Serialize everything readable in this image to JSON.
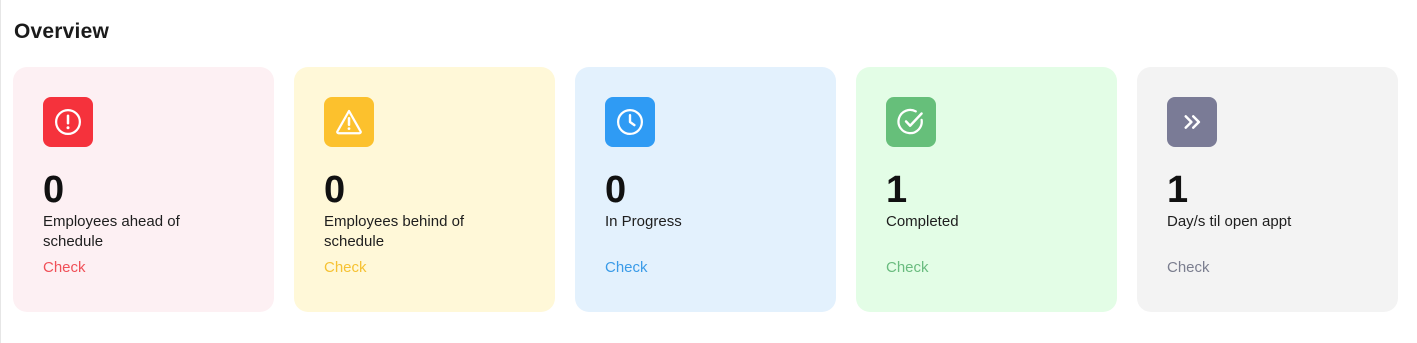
{
  "overview": {
    "title": "Overview"
  },
  "cards": [
    {
      "value": "0",
      "label": "Employees ahead of schedule",
      "check_label": "Check",
      "icon": "exclamation-circle-icon",
      "background_color": "#fdf0f3",
      "icon_color": "#f5323c",
      "check_color": "#f05058"
    },
    {
      "value": "0",
      "label": "Employees behind of schedule",
      "check_label": "Check",
      "icon": "warning-triangle-icon",
      "background_color": "#fff8d8",
      "icon_color": "#fcc12d",
      "check_color": "#f6c233"
    },
    {
      "value": "0",
      "label": "In Progress",
      "check_label": "Check",
      "icon": "clock-icon",
      "background_color": "#e3f1fd",
      "icon_color": "#2f9bf4",
      "check_color": "#3a9be8"
    },
    {
      "value": "1",
      "label": "Completed",
      "check_label": "Check",
      "icon": "check-circle-icon",
      "background_color": "#e3fde6",
      "icon_color": "#66bf7a",
      "check_color": "#6abc7f"
    },
    {
      "value": "1",
      "label": "Day/s til open appt",
      "check_label": "Check",
      "icon": "double-chevron-right-icon",
      "background_color": "#f3f3f3",
      "icon_color": "#7a7b96",
      "check_color": "#7b7e8f"
    }
  ]
}
